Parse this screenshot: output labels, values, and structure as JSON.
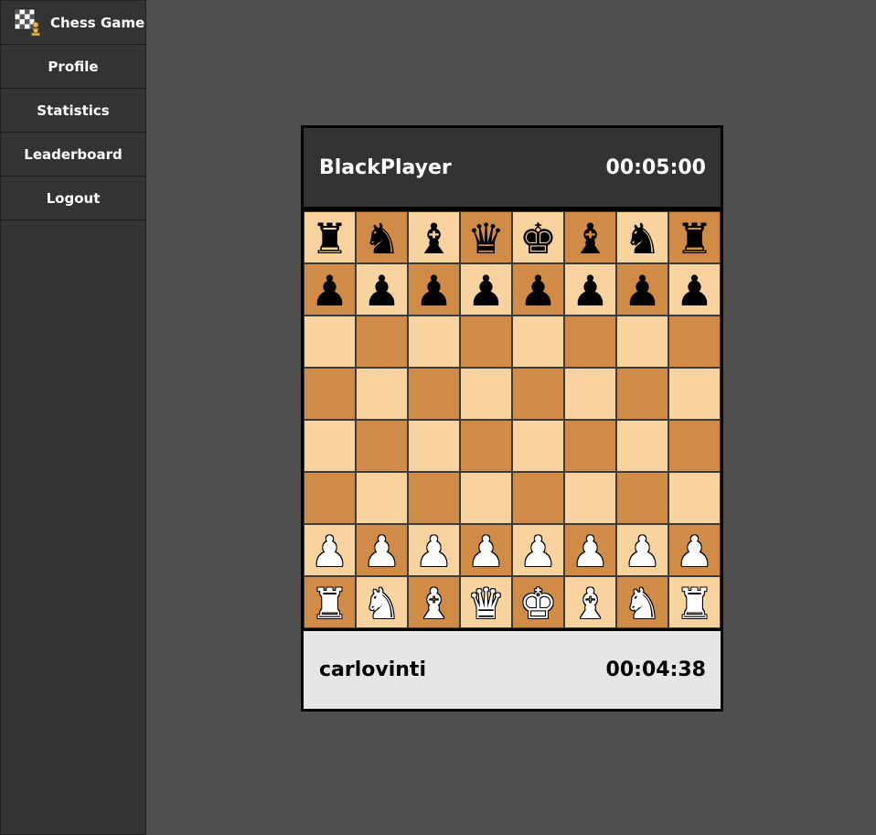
{
  "sidebar": {
    "brand_label": "Chess Game",
    "items": [
      {
        "label": "Profile",
        "name": "sidebar-item-profile"
      },
      {
        "label": "Statistics",
        "name": "sidebar-item-statistics"
      },
      {
        "label": "Leaderboard",
        "name": "sidebar-item-leaderboard"
      },
      {
        "label": "Logout",
        "name": "sidebar-item-logout"
      }
    ]
  },
  "game": {
    "top_player": {
      "name": "BlackPlayer",
      "clock": "00:05:00"
    },
    "bottom_player": {
      "name": "carlovinti",
      "clock": "00:04:38"
    },
    "board": [
      [
        "br",
        "bn",
        "bb",
        "bq",
        "bk",
        "bb",
        "bn",
        "br"
      ],
      [
        "bp",
        "bp",
        "bp",
        "bp",
        "bp",
        "bp",
        "bp",
        "bp"
      ],
      [
        "",
        "",
        "",
        "",
        "",
        "",
        "",
        ""
      ],
      [
        "",
        "",
        "",
        "",
        "",
        "",
        "",
        ""
      ],
      [
        "",
        "",
        "",
        "",
        "",
        "",
        "",
        ""
      ],
      [
        "",
        "",
        "",
        "",
        "",
        "",
        "",
        ""
      ],
      [
        "wp",
        "wp",
        "wp",
        "wp",
        "wp",
        "wp",
        "wp",
        "wp"
      ],
      [
        "wr",
        "wn",
        "wb",
        "wq",
        "wk",
        "wb",
        "wn",
        "wr"
      ]
    ]
  },
  "colors": {
    "light_square": "#f8d3a0",
    "dark_square": "#d08b47",
    "background": "#4f4f4f",
    "sidebar": "#333333"
  }
}
